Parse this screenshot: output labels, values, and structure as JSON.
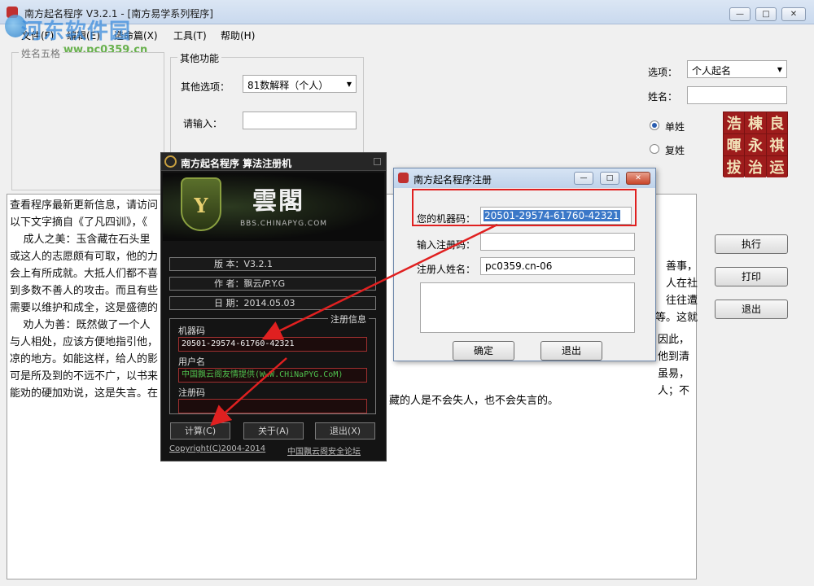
{
  "window": {
    "title": "南方起名程序 V3.2.1 - [南方易学系列程序]",
    "min": "—",
    "max": "□",
    "close": "✕"
  },
  "watermark": {
    "brand": "河东软件园",
    "url": "www.pc0359.cn"
  },
  "menu": [
    "文件(F)",
    "编辑(E)",
    "造命篇(X)",
    "工具(T)",
    "帮助(H)"
  ],
  "left_group": {
    "label": "姓名五格"
  },
  "func_group": {
    "label": "其他功能",
    "option_label": "其他选项：",
    "option_value": "81数解释（个人）",
    "input_label": "请输入："
  },
  "right_panel": {
    "option_label": "选项：",
    "option_value": "个人起名",
    "name_label": "姓名：",
    "radio_single": "单姓",
    "radio_double": "复姓",
    "chars": [
      "浩",
      "棟",
      "良",
      "暉",
      "永",
      "祺",
      "拔",
      "治",
      "运"
    ],
    "buttons": {
      "execute": "执行",
      "print": "打印",
      "exit": "退出"
    }
  },
  "content": {
    "lines": [
      "查看程序最新更新信息，请访问",
      "",
      "以下文字摘自《了凡四训》，《",
      "",
      "    成人之美：玉含藏在石头里",
      "或这人的志愿颇有可取，他的力",
      "会上有所成就。大抵人们都不喜",
      "到多数不善人的攻击。而且有些",
      "需要以维护和成全，这是盛德的",
      "    劝人为善：既然做了一个人",
      "与人相处，应该方便地指引他，",
      "凉的地方。如能这样，给人的影",
      "可是所及到的不远不广，以书来",
      "能劝的硬加劝说，这是失言。在"
    ],
    "right_fragments": [
      "善事，",
      "人在社",
      "往往遭",
      "等。这就",
      "因此，",
      "他到清",
      "虽易，",
      "人；不"
    ],
    "bottom_fragment": "藏的人是不会失人，也不会失言的。"
  },
  "keygen": {
    "title": "南方起名程序 算法注册机",
    "logo_text": "雲閣",
    "shield_letter": "Y",
    "site": "BBS.CHINAPYG.COM",
    "version_label": "版  本：",
    "version": "V3.2.1",
    "author_label": "作  者：",
    "author": "飘云/P.Y.G",
    "date_label": "日  期：",
    "date": "2014.05.03",
    "reg_group": "注册信息",
    "machine_label": "机器码",
    "machine_code": "20501-29574-61760-42321",
    "user_label": "用户名",
    "user_value": "中国飘云阁友情提供(WwW.CHiNaPYG.CoM)",
    "regcode_label": "注册码",
    "regcode_value": "",
    "btn_calc": "计算(C)",
    "btn_about": "关于(A)",
    "btn_exit": "退出(X)",
    "copyright": "Copyright(C)2004-2014",
    "forum": "中国飘云阁安全论坛"
  },
  "register_dialog": {
    "title": "南方起名程序注册",
    "machine_label": "您的机器码：",
    "machine_code": "20501-29574-61760-42321",
    "regcode_label": "输入注册码：",
    "name_label": "注册人姓名：",
    "name_value": "pc0359.cn-06",
    "ok": "确定",
    "exit": "退出"
  },
  "colors": {
    "highlight": "#e02020",
    "selection": "#3b78c8",
    "keygen_bg": "#141414"
  }
}
